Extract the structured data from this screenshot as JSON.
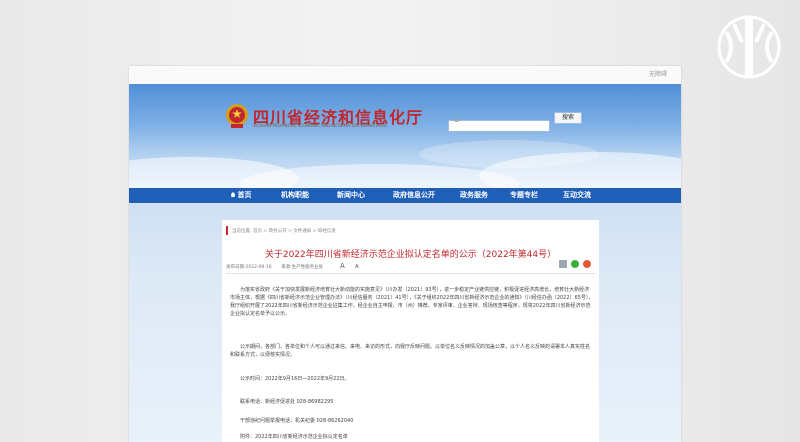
{
  "site": {
    "top_link": "无障碍",
    "title": "四川省经济和信息化厅",
    "subtitle": "SICHUAN PROVINCIAL ECONOMIC AND INFORMATION DEPARTMENT",
    "search_button": "搜索",
    "search_placeholder": ""
  },
  "nav": [
    {
      "label": "首页",
      "icon": "home-icon"
    },
    {
      "label": "机构职能"
    },
    {
      "label": "新闻中心"
    },
    {
      "label": "政府信息公开"
    },
    {
      "label": "政务服务"
    },
    {
      "label": "专题专栏"
    },
    {
      "label": "互动交流"
    }
  ],
  "article": {
    "breadcrumb": "当前位置: 首页 > 政务公开 > 文件通知 > 四经信发",
    "title": "关于2022年四川省新经济示范企业拟认定名单的公示（2022年第44号）",
    "date": "发布日期:2022-09-16",
    "source": "来源:生产性服务业处",
    "font_large": "A",
    "font_small": "A",
    "paragraphs": [
      "为落实省政府《关于加快发展新经济培育壮大新动能的实施意见》（川办发〔2021〕93号），进一步稳定产业链供应链，积极促进经济高增长，培育壮大新经济市场主体，根据《四川省新经济示范企业管理办法》（川经信服务〔2021〕41号），《关于组织2022年四川省新经济示范企业的通知》（川经信办函〔2022〕65号），我厅组织开展了2022年四川省新经济示范企业征集工作，经企业自主申报、市（州）推荐、专家评审、企业答辩、现场核查等程序，现将2022年四川省新经济示范企业拟认定名单予以公示。",
      "公示期间，各部门、各单位和个人可以通过来信、来电、来访的形式，向我厅反映问题。以单位名义反映情况的加盖公章，以个人名义反映的请署本人真实姓名和联系方式，以便核实情况。",
      "公示时间：2022年9月16日—2022年9月22日。",
      "联系电话：新经济促进处 028-86982295",
      "干部违纪问题举报电话：机关纪委 028-86262040",
      "附件：2022年四川省新经济示范企业拟认定名单"
    ]
  },
  "colors": {
    "brand_red": "#c1272d",
    "nav_blue": "#1f5fb8",
    "header_blue": "#4f8fd8"
  }
}
